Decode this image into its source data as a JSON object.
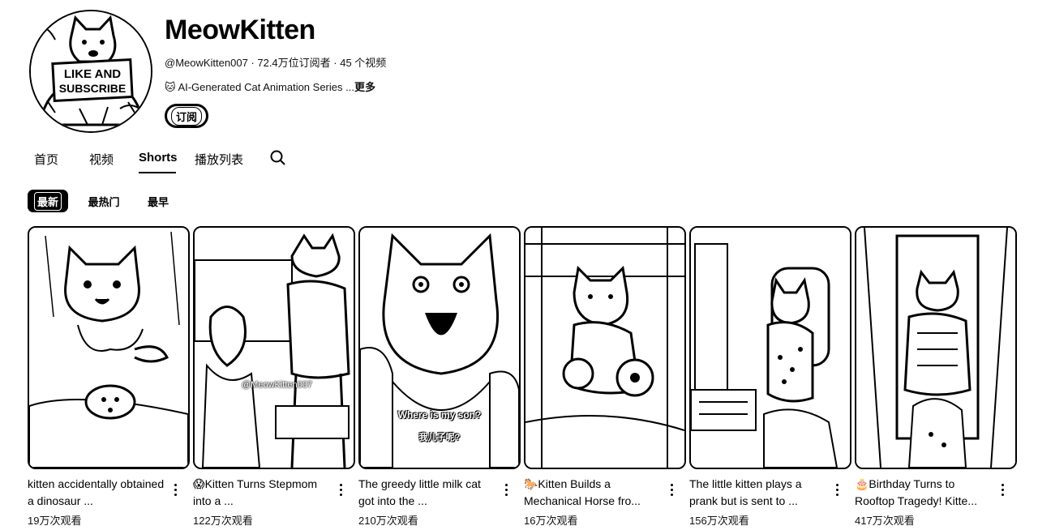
{
  "channel": {
    "name": "MeowKitten",
    "meta": "@MeowKitten007 · 72.4万位订阅者 · 45 个视频",
    "description": "🐱 AI-Generated Cat Animation Series ...",
    "more": "更多",
    "subscribe": "订阅",
    "avatar_text_1": "LIKE AND",
    "avatar_text_2": "SUBSCRIBE"
  },
  "tabs": [
    {
      "label": "首页"
    },
    {
      "label": "视频"
    },
    {
      "label": "Shorts",
      "active": true
    },
    {
      "label": "播放列表"
    }
  ],
  "chips": [
    {
      "label": "最新",
      "active": true
    },
    {
      "label": "最热门"
    },
    {
      "label": "最早"
    }
  ],
  "shorts": [
    {
      "title": "kitten accidentally obtained a dinosaur ...",
      "views": "19万次观看"
    },
    {
      "title": "😱Kitten Turns Stepmom into a ...",
      "views": "122万次观看",
      "overlay": "@MeowKitten007"
    },
    {
      "title": "The greedy little milk cat got into the ...",
      "views": "210万次观看",
      "caption_en": "Where is my son?",
      "caption_zh": "我儿子呢?"
    },
    {
      "title": "🐎Kitten Builds a Mechanical Horse fro...",
      "views": "16万次观看"
    },
    {
      "title": "The little kitten plays a prank but is sent to ...",
      "views": "156万次观看"
    },
    {
      "title": "🎂Birthday Turns to Rooftop Tragedy! Kitte...",
      "views": "417万次观看"
    }
  ]
}
